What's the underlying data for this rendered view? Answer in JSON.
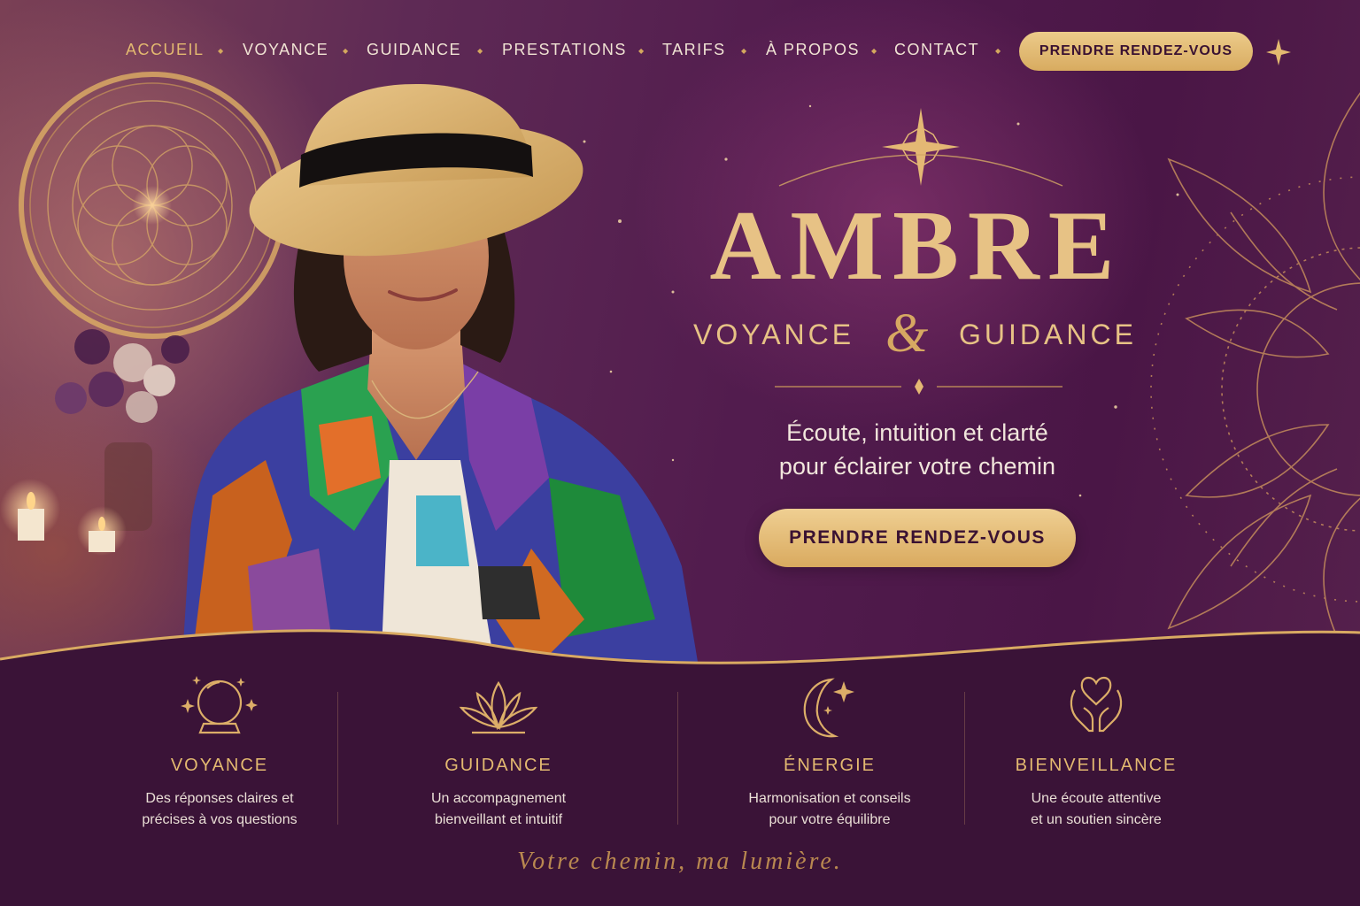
{
  "nav": {
    "items": [
      {
        "label": "ACCUEIL",
        "active": true
      },
      {
        "label": "VOYANCE",
        "active": false
      },
      {
        "label": "GUIDANCE",
        "active": false
      },
      {
        "label": "PRESTATIONS",
        "active": false
      },
      {
        "label": "TARIFS",
        "active": false
      },
      {
        "label": "À PROPOS",
        "active": false
      },
      {
        "label": "CONTACT",
        "active": false
      }
    ],
    "cta_label": "PRENDRE RENDEZ-VOUS",
    "star_icon": "sparkle-icon"
  },
  "hero": {
    "brand": "AMBRE",
    "subtitle_left": "VOYANCE",
    "subtitle_ampersand": "&",
    "subtitle_right": "GUIDANCE",
    "tagline_line1": "Écoute, intuition et clarté",
    "tagline_line2": "pour éclairer votre chemin",
    "cta_label": "PRENDRE RENDEZ-VOUS"
  },
  "features": [
    {
      "icon": "crystal-ball-icon",
      "title": "VOYANCE",
      "desc_line1": "Des réponses claires et",
      "desc_line2": "précises à vos questions"
    },
    {
      "icon": "lotus-icon",
      "title": "GUIDANCE",
      "desc_line1": "Un accompagnement",
      "desc_line2": "bienveillant et intuitif"
    },
    {
      "icon": "moon-star-icon",
      "title": "ÉNERGIE",
      "desc_line1": "Harmonisation et conseils",
      "desc_line2": "pour votre équilibre"
    },
    {
      "icon": "heart-hands-icon",
      "title": "BIENVEILLANCE",
      "desc_line1": "Une écoute attentive",
      "desc_line2": "et un soutien sincère"
    }
  ],
  "footer": {
    "motto": "Votre chemin, ma lumière."
  },
  "colors": {
    "gold": "#e3b970",
    "deep_purple": "#3d1438",
    "plum": "#521c4e",
    "cream": "#f1e4d4"
  }
}
